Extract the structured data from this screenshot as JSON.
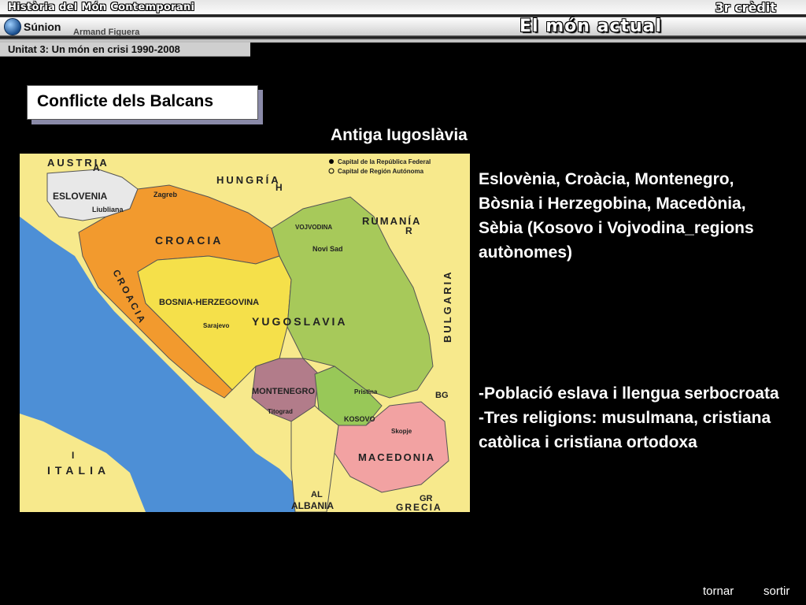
{
  "header": {
    "course_title": "Història del Món Contemporani",
    "credit": "3r crèdit",
    "topic": "El món actual",
    "logo_text": "Súnion",
    "author": "Armand Figuera",
    "unit": "Unitat 3: Un món en crisi 1990-2008"
  },
  "slide": {
    "title": "Conflicte dels Balcans",
    "subtitle": "Antiga Iugoslàvia",
    "text_block_1": "Eslovènia, Croàcia, Montenegro, Bòsnia i Herzegobina, Macedònia, Sèbia (Kosovo i Vojvodina_regions autònomes)",
    "text_block_2_lines": [
      "-Població eslava i llengua serbocroata",
      "-Tres religions: musulmana, cristiana catòlica i cristiana ortodoxa"
    ]
  },
  "map": {
    "legend": [
      "Capital de la República Federal",
      "Capital de Región Autónoma"
    ],
    "labels": {
      "austria": "AUSTRIA",
      "austria_code": "A",
      "hungria": "HUNGRÍA",
      "hungria_code": "H",
      "rumania": "RUMANÍA",
      "rumania_code": "R",
      "eslovenia": "ESLOVENIA",
      "ljubljana": "Liubliana",
      "zagreb": "Zagreb",
      "croacia": "CROACIA",
      "croacia_coast": "CROACIA",
      "vojvodina": "VOJVODINA",
      "novi_sad": "Novi Sad",
      "bosnia": "BOSNIA-HERZEGOVINA",
      "sarajevo": "Sarajevo",
      "yugoslavia": "YUGOSLAVIA",
      "montenegro": "MONTENEGRO",
      "titograd": "Titograd",
      "pristina": "Pristina",
      "kosovo": "KOSOVO",
      "skopje": "Skopje",
      "macedonia": "MACEDONIA",
      "bulgaria": "BULGARIA",
      "bulgaria_code": "BG",
      "italia": "ITALIA",
      "italia_code": "I",
      "albania": "ALBANIA",
      "albania_code": "AL",
      "grecia": "GRECIA",
      "grecia_code": "GR"
    }
  },
  "nav": {
    "back": "tornar",
    "exit": "sortir"
  },
  "colors": {
    "eslovenia": "#e8e8e8",
    "croacia": "#f29a2e",
    "bosnia": "#f5e04a",
    "serbia": "#a7c95a",
    "montenegro": "#b27c8a",
    "kosovo": "#98c858",
    "macedonia": "#f2a2a2",
    "foreign": "#f7e98c",
    "sea": "#4d8fd6"
  }
}
